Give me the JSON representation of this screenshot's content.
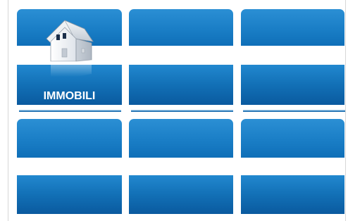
{
  "tiles": [
    {
      "label": "IMMOBILI",
      "icon": "house-icon"
    },
    {
      "label": ""
    },
    {
      "label": ""
    },
    {
      "label": ""
    },
    {
      "label": ""
    },
    {
      "label": ""
    }
  ],
  "colors": {
    "tile_top": "#1a7ec6",
    "tile_bottom": "#0a5a9f",
    "label_text": "#ffffff"
  }
}
